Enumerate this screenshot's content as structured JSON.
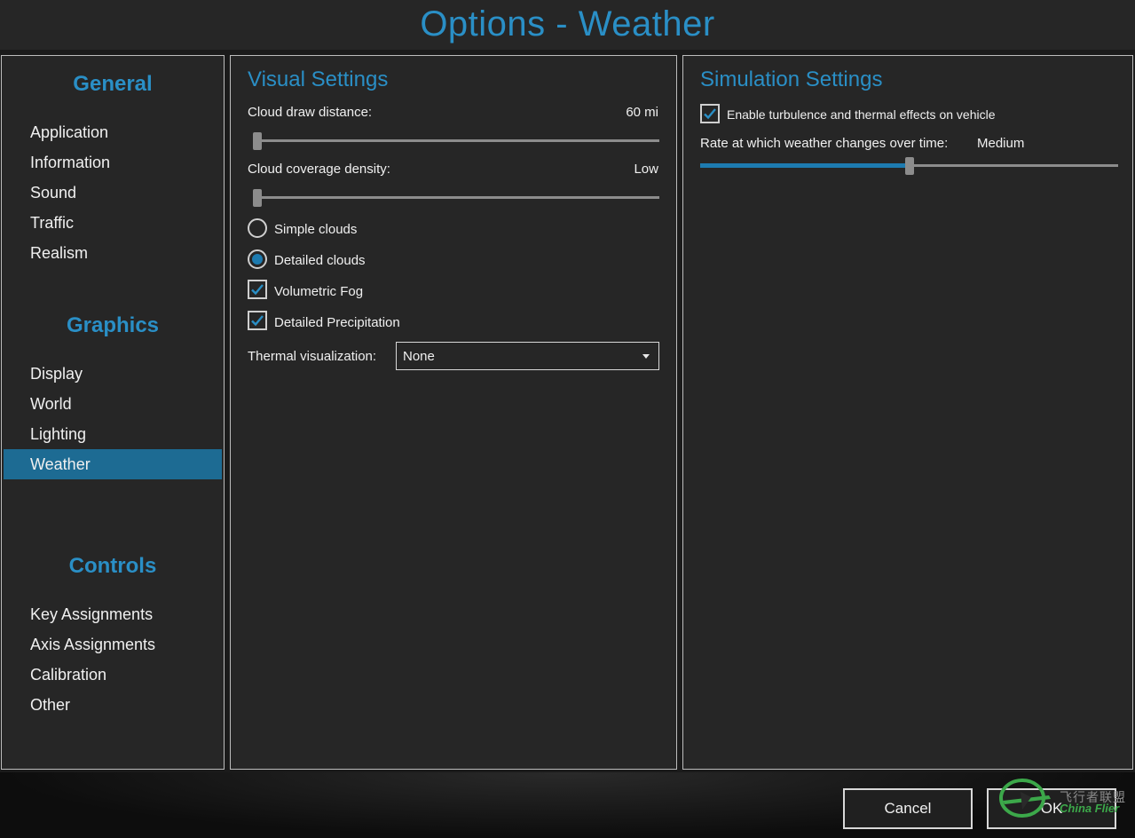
{
  "window_title": "Options - Weather",
  "sidebar": {
    "sections": [
      {
        "title": "General",
        "items": [
          "Application",
          "Information",
          "Sound",
          "Traffic",
          "Realism"
        ]
      },
      {
        "title": "Graphics",
        "items": [
          "Display",
          "World",
          "Lighting",
          "Weather"
        ]
      },
      {
        "title": "Controls",
        "items": [
          "Key Assignments",
          "Axis Assignments",
          "Calibration",
          "Other"
        ]
      }
    ],
    "active_item": "Weather"
  },
  "visual": {
    "title": "Visual Settings",
    "cloud_draw_distance": {
      "label": "Cloud draw distance:",
      "value": "60 mi",
      "slider_fraction": 0.0
    },
    "cloud_coverage_density": {
      "label": "Cloud coverage density:",
      "value": "Low",
      "slider_fraction": 0.0
    },
    "simple_clouds": {
      "label": "Simple clouds",
      "selected": false
    },
    "detailed_clouds": {
      "label": "Detailed clouds",
      "selected": true
    },
    "volumetric_fog": {
      "label": "Volumetric Fog",
      "checked": true
    },
    "detailed_precipitation": {
      "label": "Detailed Precipitation",
      "checked": true
    },
    "thermal_visualization": {
      "label": "Thermal visualization:",
      "value": "None"
    }
  },
  "simulation": {
    "title": "Simulation Settings",
    "turbulence": {
      "label": "Enable turbulence and thermal effects on vehicle",
      "checked": true
    },
    "weather_rate": {
      "label": "Rate at which weather changes over time:",
      "value": "Medium",
      "slider_fraction": 0.5
    }
  },
  "buttons": {
    "cancel": "Cancel",
    "ok": "OK"
  },
  "watermark": {
    "chinese": "飞行者联盟",
    "english": "China Flier"
  },
  "colors": {
    "accent": "#2a8fc6",
    "selection": "#1d6b93",
    "panel": "#262626",
    "border": "#bdbdbd"
  }
}
